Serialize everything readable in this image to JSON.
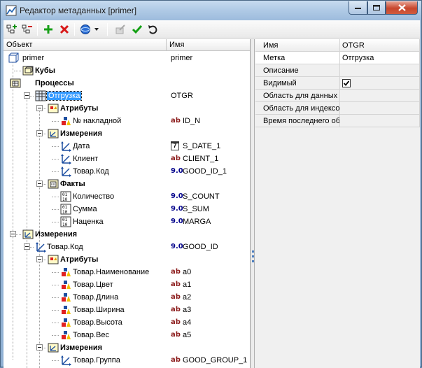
{
  "window": {
    "title": "Редактор метаданных [primer]",
    "controls": {
      "minimize": "min-icon",
      "maximize": "max-icon",
      "close": "close-icon"
    }
  },
  "toolbar": {
    "buttons": [
      {
        "name": "add-tree-node-icon"
      },
      {
        "name": "remove-tree-node-icon"
      },
      {
        "name": "add-icon"
      },
      {
        "name": "delete-icon"
      },
      {
        "name": "globe-dropdown-icon"
      },
      {
        "name": "edit-disabled-icon"
      },
      {
        "name": "apply-check-icon"
      },
      {
        "name": "undo-icon"
      }
    ]
  },
  "tree": {
    "columns": {
      "object": "Объект",
      "name": "Имя"
    },
    "items": [
      {
        "label": "primer",
        "code": "primer",
        "icon": "cube-root-icon"
      },
      {
        "label": "Кубы",
        "icon": "folder-cubes-icon"
      },
      {
        "label": "Процессы",
        "icon": "folder-processes-icon"
      },
      {
        "label": "Отгрузка",
        "code": "OTGR",
        "icon": "process-table-icon"
      },
      {
        "label": "Атрибуты",
        "icon": "folder-attributes-icon"
      },
      {
        "label": "№ накладной",
        "type": "ab",
        "code": "ID_N",
        "icon": "attribute-icon"
      },
      {
        "label": "Измерения",
        "icon": "folder-dimensions-icon"
      },
      {
        "label": "Дата",
        "type": "7",
        "code": "S_DATE_1",
        "icon": "dimension-icon"
      },
      {
        "label": "Клиент",
        "type": "ab",
        "code": "CLIENT_1",
        "icon": "dimension-icon"
      },
      {
        "label": "Товар.Код",
        "type": "9.0",
        "code": "GOOD_ID_1",
        "icon": "dimension-icon"
      },
      {
        "label": "Факты",
        "icon": "folder-facts-icon"
      },
      {
        "label": "Количество",
        "type": "9.0",
        "code": "S_COUNT",
        "icon": "fact-icon"
      },
      {
        "label": "Сумма",
        "type": "9.0",
        "code": "S_SUM",
        "icon": "fact-icon"
      },
      {
        "label": "Наценка",
        "type": "9.0",
        "code": "MARGA",
        "icon": "fact-icon"
      },
      {
        "label": "Измерения",
        "icon": "folder-dimensions-icon"
      },
      {
        "label": "Товар.Код",
        "type": "9.0",
        "code": "GOOD_ID",
        "icon": "dimension-icon"
      },
      {
        "label": "Атрибуты",
        "icon": "folder-attributes-icon"
      },
      {
        "label": "Товар.Наименование",
        "type": "ab",
        "code": "a0",
        "icon": "attribute-icon"
      },
      {
        "label": "Товар.Цвет",
        "type": "ab",
        "code": "a1",
        "icon": "attribute-icon"
      },
      {
        "label": "Товар.Длина",
        "type": "ab",
        "code": "a2",
        "icon": "attribute-icon"
      },
      {
        "label": "Товар.Ширина",
        "type": "ab",
        "code": "a3",
        "icon": "attribute-icon"
      },
      {
        "label": "Товар.Высота",
        "type": "ab",
        "code": "a4",
        "icon": "attribute-icon"
      },
      {
        "label": "Товар.Вес",
        "type": "ab",
        "code": "a5",
        "icon": "attribute-icon"
      },
      {
        "label": "Измерения",
        "icon": "folder-dimensions-icon"
      },
      {
        "label": "Товар.Группа",
        "type": "ab",
        "code": "GOOD_GROUP_1",
        "icon": "dimension-icon"
      }
    ]
  },
  "props": {
    "columns": {
      "name": "Имя",
      "value": "OTGR"
    },
    "rows": [
      {
        "name": "Метка",
        "value": "Отгрузка"
      },
      {
        "name": "Описание",
        "value": ""
      },
      {
        "name": "Видимый",
        "value": "",
        "checked": true
      },
      {
        "name": "Область для данных",
        "value": ""
      },
      {
        "name": "Область для индексо",
        "value": ""
      },
      {
        "name": "Время последнего об",
        "value": ""
      }
    ]
  },
  "colors": {
    "selection": "#3399ff",
    "type_ab": "#8b1a1a",
    "type_num": "#00008b"
  }
}
